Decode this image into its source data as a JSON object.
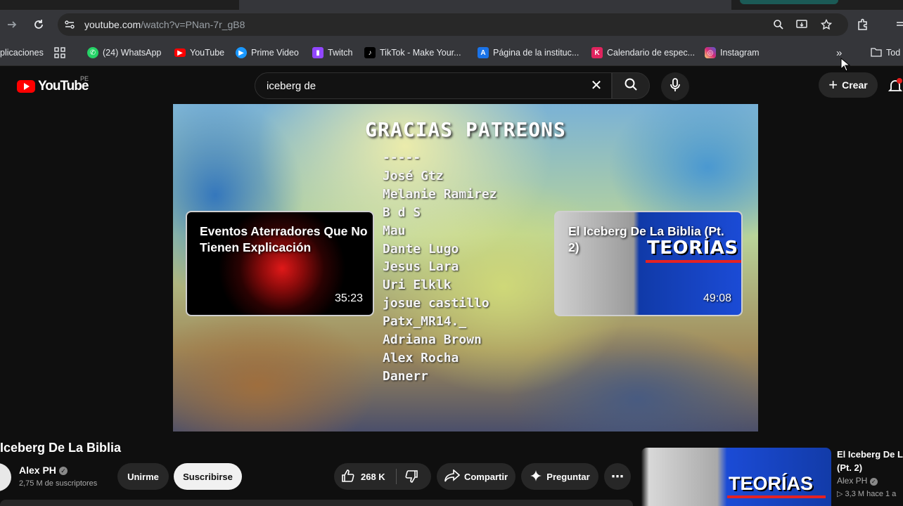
{
  "browser": {
    "url_host": "youtube.com",
    "url_path": "/watch?v=PNan-7r_gB8"
  },
  "bookmarks": {
    "apps_label": "plicaciones",
    "items": [
      {
        "label": "(24) WhatsApp",
        "icon": "whatsapp-icon",
        "color": "#25d366"
      },
      {
        "label": "YouTube",
        "icon": "youtube-icon",
        "color": "#ff0000"
      },
      {
        "label": "Prime Video",
        "icon": "prime-video-icon",
        "color": "#1a98ff"
      },
      {
        "label": "Twitch",
        "icon": "twitch-icon",
        "color": "#9146ff"
      },
      {
        "label": "TikTok - Make Your...",
        "icon": "tiktok-icon",
        "color": "#000000"
      },
      {
        "label": "Página de la instituc...",
        "icon": "institution-icon",
        "color": "#1a73e8"
      },
      {
        "label": "Calendario de espec...",
        "icon": "calendar-icon",
        "color": "#e0245e"
      },
      {
        "label": "Instagram",
        "icon": "instagram-icon",
        "color": "#d62976"
      }
    ],
    "folder_label": "Tod"
  },
  "masthead": {
    "logo_text": "YouTube",
    "country_code": "PE",
    "search_value": "iceberg de",
    "create_label": "Crear"
  },
  "video": {
    "credits_title": "GRACIAS PATREONS",
    "credits": [
      "-----",
      "José Gtz",
      "Melanie Ramirez",
      "B d S",
      "Mau",
      "Dante Lugo",
      "Jesus Lara",
      "Uri Elklk",
      "josue castillo",
      "Patx_MR14._",
      "Adriana Brown",
      "Alex Rocha",
      "Danerr"
    ],
    "endcards": [
      {
        "title": "Eventos Aterradores Que No Tienen Explicación",
        "duration": "35:23"
      },
      {
        "title": "El Iceberg De La Biblia (Pt. 2)",
        "duration": "49:08",
        "badge": "TEORÍAS"
      }
    ]
  },
  "watch": {
    "title": "Iceberg De La Biblia",
    "channel": "Alex PH",
    "subscribers": "2,75 M de suscriptores",
    "join_label": "Unirme",
    "subscribe_label": "Suscribirse",
    "likes": "268 K",
    "share_label": "Compartir",
    "ask_label": "Preguntar"
  },
  "recommendation": {
    "title_line1": "El Iceberg De La",
    "title_line2": "(Pt. 2)",
    "channel": "Alex PH",
    "meta": "▷ 3,3 M  hace 1 a",
    "badge": "TEORÍAS"
  },
  "colors": {
    "accent_red": "#ff0000",
    "background": "#0f0f0f"
  }
}
